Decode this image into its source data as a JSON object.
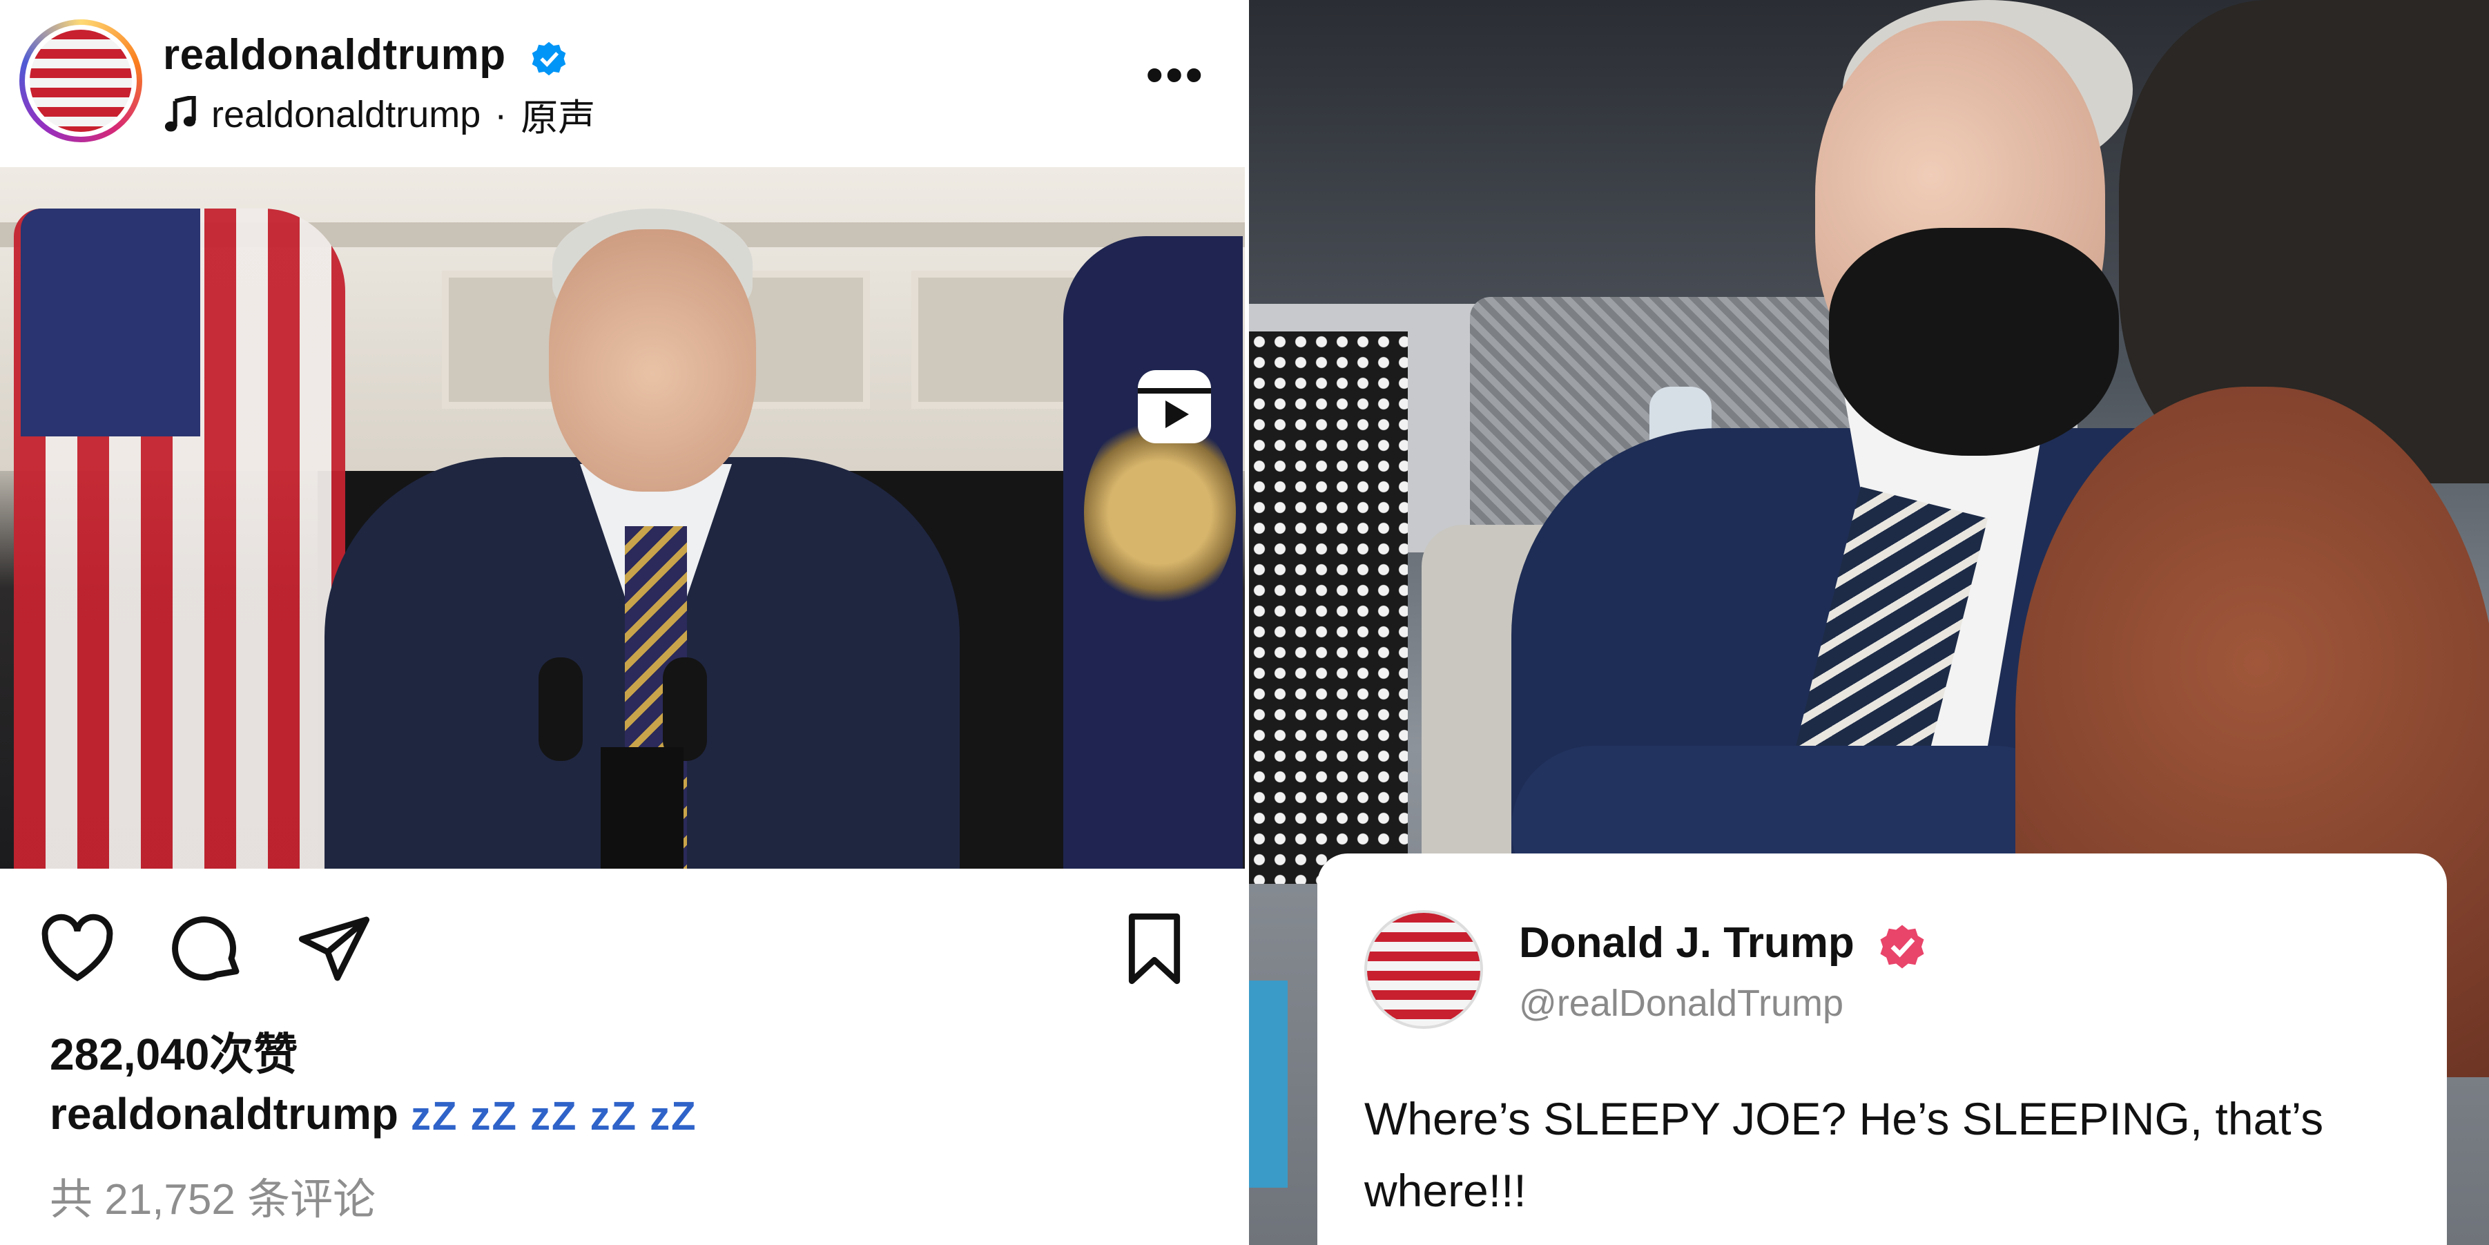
{
  "post": {
    "username": "realdonaldtrump",
    "audio_user": "realdonaldtrump",
    "audio_separator": "·",
    "audio_label": "原声",
    "more_label": "•••",
    "sound_icon": "🔊",
    "likes": "282,040次赞",
    "caption_user": "realdonaldtrump",
    "caption_text": "zZ zZ zZ zZ zZ",
    "comments": "共 21,752 条评论"
  },
  "tweet": {
    "name": "Donald J. Trump",
    "handle": "@realDonaldTrump",
    "text": "Where’s SLEEPY JOE? He’s SLEEPING, that’s where!!!"
  },
  "colors": {
    "verified_blue": "#0095f6",
    "verified_pink": "#e9446a",
    "caption_emoji": "#2f63c9",
    "muted_text": "#8e8e8e"
  },
  "icons": [
    "verified-badge-icon",
    "music-note-icon",
    "more-icon",
    "reels-icon",
    "sound-icon",
    "heart-icon",
    "comment-icon",
    "share-icon",
    "bookmark-icon"
  ]
}
